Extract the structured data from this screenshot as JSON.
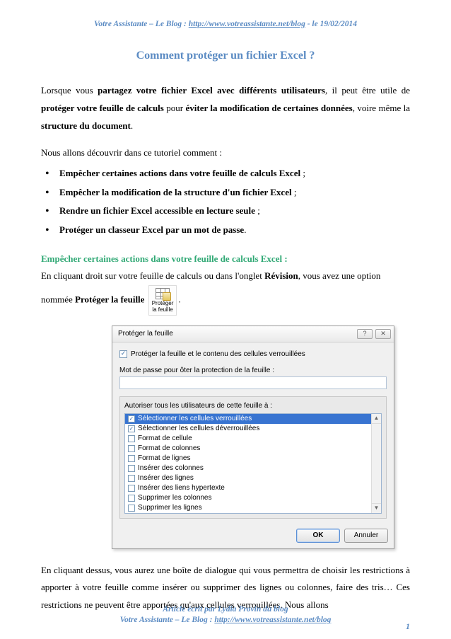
{
  "header": {
    "brand": "Votre Assistante – Le Blog : ",
    "url": "http://www.votreassistante.net/blog",
    "date_suffix": " - le 19/02/2014"
  },
  "title": "Comment protéger un fichier Excel ?",
  "intro": {
    "p1_a": "Lorsque vous ",
    "p1_b": "partagez votre fichier Excel avec différents utilisateurs",
    "p1_c": ", il peut être utile de ",
    "p1_d": "protéger votre feuille de calculs",
    "p1_e": " pour ",
    "p1_f": "éviter la modification de certaines données",
    "p1_g": ", voire même la ",
    "p1_h": "structure du document",
    "p1_i": "."
  },
  "lead": "Nous allons découvrir dans ce tutoriel comment :",
  "bullets": [
    "Empêcher certaines actions dans votre feuille de calculs Excel",
    "Empêcher la modification de la structure d'un fichier Excel",
    "Rendre un fichier Excel accessible en lecture seule",
    "Protéger un classeur Excel par un mot de passe"
  ],
  "section_title": "Empêcher certaines actions dans votre feuille de calculs Excel :",
  "para2_a": "En cliquant droit sur votre feuille de calculs ou dans l'onglet ",
  "para2_b": "Révision",
  "para2_c": ", vous avez une option",
  "para3_a": "nommée ",
  "para3_b": "Protéger la feuille",
  "ribbon": {
    "line1": "Protéger",
    "line2": "la feuille"
  },
  "dialog": {
    "title": "Protéger la feuille",
    "help_glyph": "?",
    "close_glyph": "✕",
    "top_check_label": "Protéger la feuille et le contenu des cellules verrouillées",
    "password_label": "Mot de passe pour ôter la protection de la feuille :",
    "list_label": "Autoriser tous les utilisateurs de cette feuille à :",
    "items": [
      {
        "label": "Sélectionner les cellules verrouillées",
        "checked": true,
        "selected": true
      },
      {
        "label": "Sélectionner les cellules déverrouillées",
        "checked": true,
        "selected": false
      },
      {
        "label": "Format de cellule",
        "checked": false,
        "selected": false
      },
      {
        "label": "Format de colonnes",
        "checked": false,
        "selected": false
      },
      {
        "label": "Format de lignes",
        "checked": false,
        "selected": false
      },
      {
        "label": "Insérer des colonnes",
        "checked": false,
        "selected": false
      },
      {
        "label": "Insérer des lignes",
        "checked": false,
        "selected": false
      },
      {
        "label": "Insérer des liens hypertexte",
        "checked": false,
        "selected": false
      },
      {
        "label": "Supprimer les colonnes",
        "checked": false,
        "selected": false
      },
      {
        "label": "Supprimer les lignes",
        "checked": false,
        "selected": false
      }
    ],
    "ok": "OK",
    "cancel": "Annuler"
  },
  "closing": "En cliquant dessus, vous aurez une boîte de dialogue qui vous permettra de choisir les restrictions à apporter à votre feuille comme insérer ou supprimer des lignes ou colonnes, faire des tris… Ces restrictions ne peuvent être apportées qu'aux cellules verrouillées. Nous allons",
  "footer": {
    "line1": "Article écrit par Lydia Provin du blog",
    "line2_prefix": "Votre Assistante – Le Blog : ",
    "line2_url": "http://www.votreassistante.net/blog"
  },
  "page_number": "1"
}
